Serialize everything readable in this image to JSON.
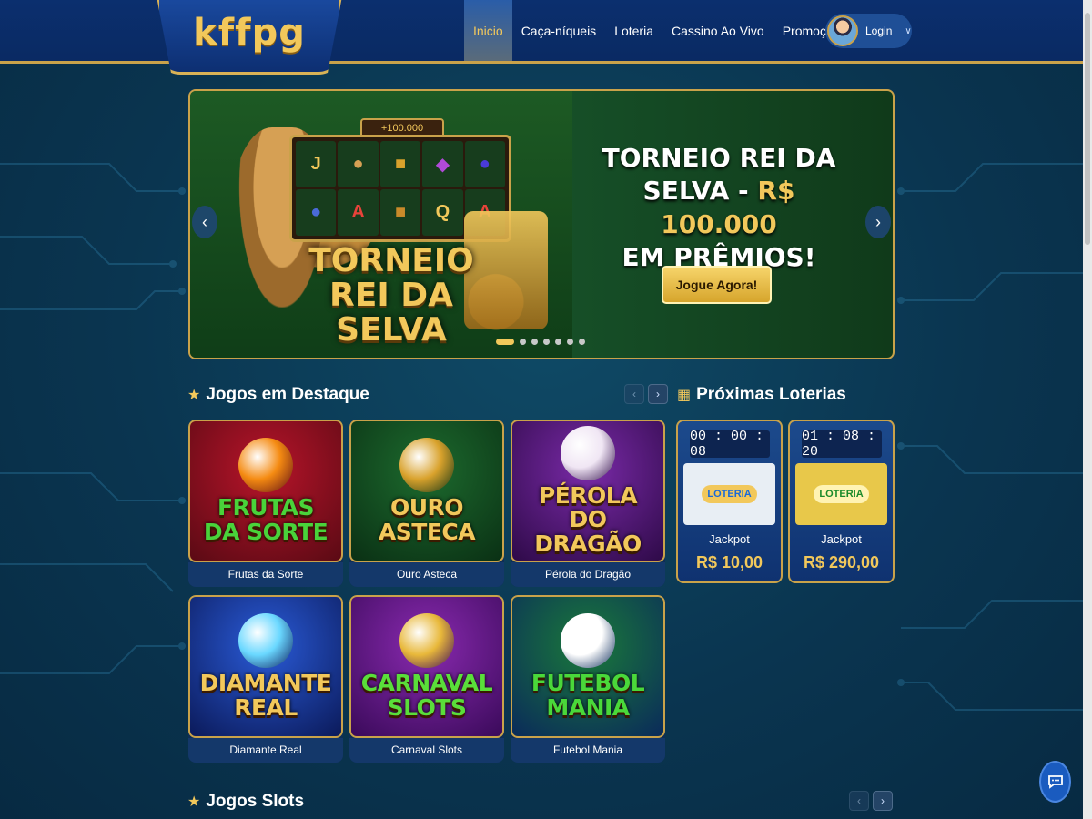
{
  "header": {
    "logo": "kffpg",
    "nav": [
      {
        "label": "Inicio",
        "active": true
      },
      {
        "label": "Caça-níqueis",
        "active": false
      },
      {
        "label": "Loteria",
        "active": false
      },
      {
        "label": "Cassino Ao Vivo",
        "active": false
      },
      {
        "label": "Promoções",
        "active": false
      }
    ],
    "login_label": "Login"
  },
  "banner": {
    "slot_prize": "+100.000",
    "slot_symbols": [
      "J",
      "",
      "",
      "",
      "",
      "",
      "A",
      "",
      "Q",
      "A"
    ],
    "logo_line1": "TORNEIO",
    "logo_line2": "REI DA SELVA",
    "promo_line1": "TORNEIO REI DA",
    "promo_line2_white": "SELVA - ",
    "promo_line2_gold": "R$ 100.000",
    "promo_line3": "EM PRÊMIOS!",
    "cta": "Jogue Agora!",
    "slides": 7,
    "active_slide": 0
  },
  "featured": {
    "title": "Jogos em Destaque",
    "games": [
      {
        "name": "Frutas da Sorte",
        "art_line1": "FRUTAS",
        "art_line2": "DA SORTE",
        "bg1": "#b8142a",
        "bg2": "#5a0a14",
        "text_color": "#49d33a",
        "icon": "fruit-icon",
        "icon_color": "#f58b12"
      },
      {
        "name": "Ouro Asteca",
        "art_line1": "OURO",
        "art_line2": "ASTECA",
        "bg1": "#1d6b2e",
        "bg2": "#0a3014",
        "text_color": "#f2c85b",
        "icon": "aztec-mask-icon",
        "icon_color": "#d9a22c"
      },
      {
        "name": "Pérola do Dragão",
        "art_line1": "PÉROLA",
        "art_line2": "DO DRAGÃO",
        "bg1": "#7a2aa8",
        "bg2": "#2e0a48",
        "text_color": "#f2c85b",
        "icon": "pearl-dragon-icon",
        "icon_color": "#f0e6f4"
      },
      {
        "name": "Diamante Real",
        "art_line1": "DIAMANTE",
        "art_line2": "REAL",
        "bg1": "#2a5bd8",
        "bg2": "#0b1a5a",
        "text_color": "#f2c85b",
        "icon": "diamond-icon",
        "icon_color": "#6ad8ff"
      },
      {
        "name": "Carnaval Slots",
        "art_line1": "CARNAVAL",
        "art_line2": "SLOTS",
        "bg1": "#8a2ab0",
        "bg2": "#3a0a5a",
        "text_color": "#5ade3a",
        "icon": "carnival-mask-icon",
        "icon_color": "#e8b83a"
      },
      {
        "name": "Futebol Mania",
        "art_line1": "FUTEBOL",
        "art_line2": "MANIA",
        "bg1": "#1a7a3a",
        "bg2": "#0a2a5a",
        "text_color": "#4ad83a",
        "icon": "soccer-ball-icon",
        "icon_color": "#ffffff"
      }
    ]
  },
  "lotteries": {
    "title": "Próximas Loterias",
    "items": [
      {
        "timer": "00 : 00 : 08",
        "label": "Jackpot",
        "value": "R$ 10,00",
        "logo_text": "LOTERIA",
        "bg": "#e8eef4",
        "text_color": "#1a6ad8"
      },
      {
        "timer": "01 : 08 : 20",
        "label": "Jackpot",
        "value": "R$ 290,00",
        "logo_text": "LOTERIA",
        "bg": "#e8c84a",
        "text_color": "#1a8a2a"
      }
    ]
  },
  "slots_section": {
    "title": "Jogos Slots"
  },
  "colors": {
    "gold": "#f2c85b",
    "header_bg": "#0b2f6e",
    "page_bg": "#0a3550"
  }
}
